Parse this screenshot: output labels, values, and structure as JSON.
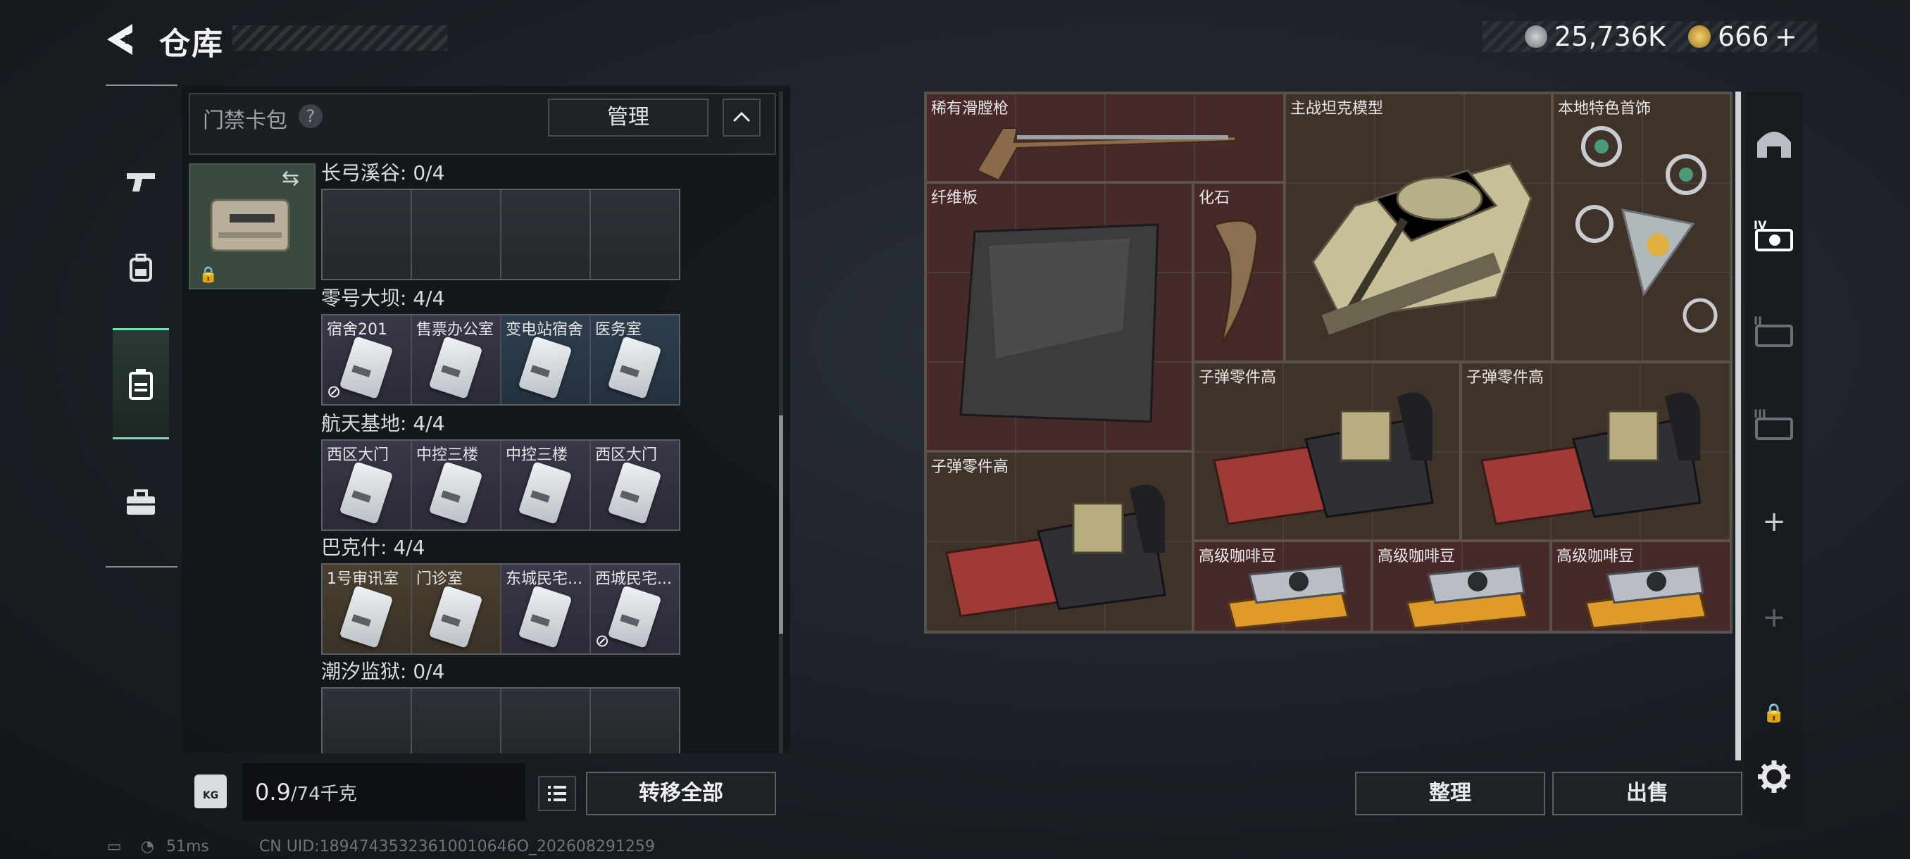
{
  "header": {
    "title": "仓库"
  },
  "currency": {
    "primary_value": "25,736K",
    "secondary_value": "666",
    "add_symbol": "+"
  },
  "left_tabs": [
    {
      "icon": "gun-icon"
    },
    {
      "icon": "backpack-icon"
    },
    {
      "icon": "keycard-case-icon",
      "active": true
    },
    {
      "icon": "briefcase-icon"
    }
  ],
  "keycard_bag": {
    "title": "门禁卡包",
    "help": "?",
    "manage_label": "管理"
  },
  "sections": [
    {
      "label": "长弓溪谷: 0/4",
      "slots": [
        {
          "name": ""
        },
        {
          "name": ""
        },
        {
          "name": ""
        },
        {
          "name": ""
        }
      ]
    },
    {
      "label": "零号大坝: 4/4",
      "slots": [
        {
          "name": "宿舍201",
          "bg": "purple",
          "no_link": true
        },
        {
          "name": "售票办公室",
          "bg": "purple"
        },
        {
          "name": "变电站宿舍",
          "bg": "blue"
        },
        {
          "name": "医务室",
          "bg": "blue"
        }
      ]
    },
    {
      "label": "航天基地: 4/4",
      "slots": [
        {
          "name": "西区大门",
          "bg": "purple"
        },
        {
          "name": "中控三楼",
          "bg": "purple"
        },
        {
          "name": "中控三楼",
          "bg": "purple"
        },
        {
          "name": "西区大门",
          "bg": "purple"
        }
      ]
    },
    {
      "label": "巴克什: 4/4",
      "slots": [
        {
          "name": "1号审讯室",
          "bg": "gold"
        },
        {
          "name": "门诊室",
          "bg": "gold"
        },
        {
          "name": "东城民宅...",
          "bg": "purple"
        },
        {
          "name": "西城民宅...",
          "bg": "purple",
          "no_link": true
        }
      ]
    },
    {
      "label": "潮汐监狱: 0/4",
      "slots": [
        {
          "name": ""
        },
        {
          "name": ""
        },
        {
          "name": ""
        },
        {
          "name": ""
        }
      ]
    }
  ],
  "weight": {
    "icon_text": "KG",
    "current": "0.9",
    "max": "/74千克"
  },
  "bottom_left": {
    "transfer_all_label": "转移全部"
  },
  "stash_items": [
    {
      "id": "flintlock",
      "name": "稀有滑膛枪",
      "color": "red"
    },
    {
      "id": "tank",
      "name": "主战坦克模型",
      "color": "brown"
    },
    {
      "id": "jewelry",
      "name": "本地特色首饰",
      "color": "brown"
    },
    {
      "id": "fiber",
      "name": "纤维板",
      "color": "red"
    },
    {
      "id": "fossil",
      "name": "化石",
      "color": "red"
    },
    {
      "id": "ammo1",
      "name": "子弹零件高",
      "color": "brown"
    },
    {
      "id": "ammo2",
      "name": "子弹零件高",
      "color": "brown"
    },
    {
      "id": "ammo3",
      "name": "子弹零件高",
      "color": "brown"
    },
    {
      "id": "coffee1",
      "name": "高级咖啡豆",
      "color": "red"
    },
    {
      "id": "coffee2",
      "name": "高级咖啡豆",
      "color": "red"
    },
    {
      "id": "coffee3",
      "name": "高级咖啡豆",
      "color": "red"
    }
  ],
  "right_tabs": [
    "dome-icon",
    "tier-4-vault-icon",
    "tier-2-vault-icon",
    "tier-3-vault-icon",
    "add-icon",
    "add-disabled-icon",
    "lock-icon",
    "gear-icon"
  ],
  "actions": {
    "sort_label": "整理",
    "sell_label": "出售"
  },
  "status": {
    "ping": "51ms",
    "uid": "CN UID:18947435323610010646O_202608291259"
  }
}
